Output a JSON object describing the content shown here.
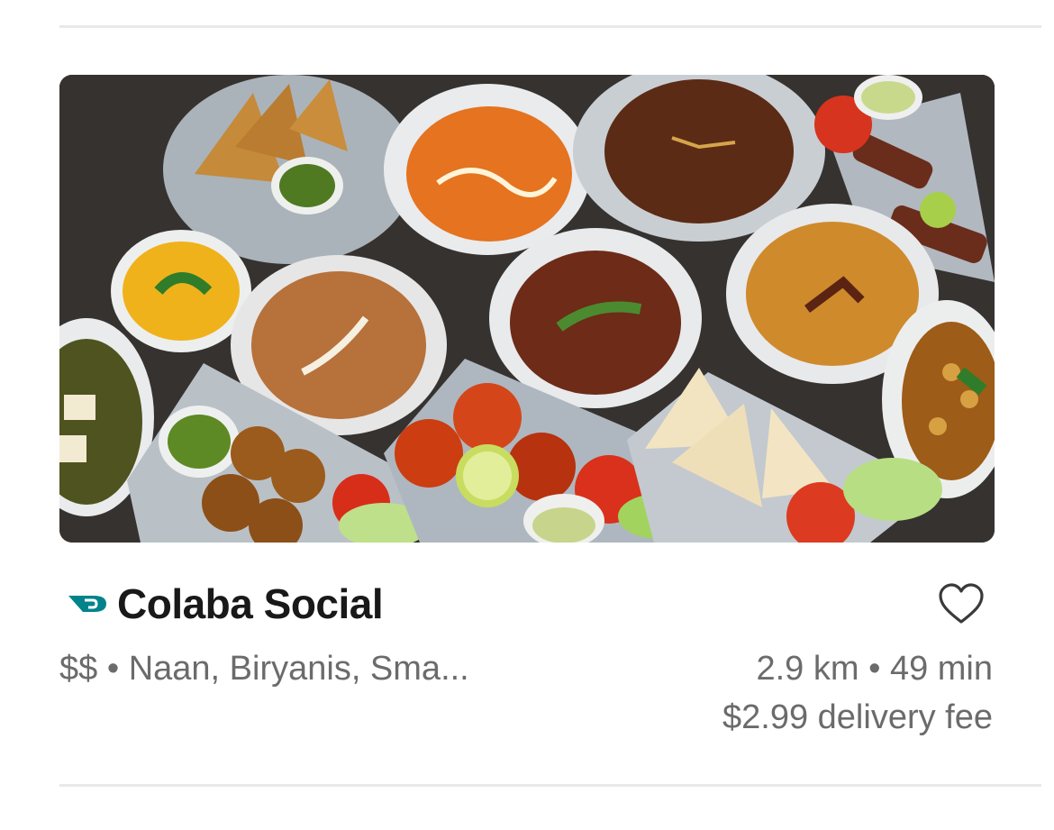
{
  "restaurant": {
    "name": "Colaba Social",
    "price_tier": "$$",
    "separator": " • ",
    "cuisines": "Naan, Biryanis, Sma...",
    "distance": "2.9 km",
    "duration": "49 min",
    "delivery_fee": "$2.99 delivery fee",
    "dashpass_icon": "dashpass-logo-icon",
    "favorite_icon": "heart-outline-icon",
    "colors": {
      "dashpass": "#00838a",
      "title": "#191919",
      "meta": "#6b6b6b"
    }
  }
}
